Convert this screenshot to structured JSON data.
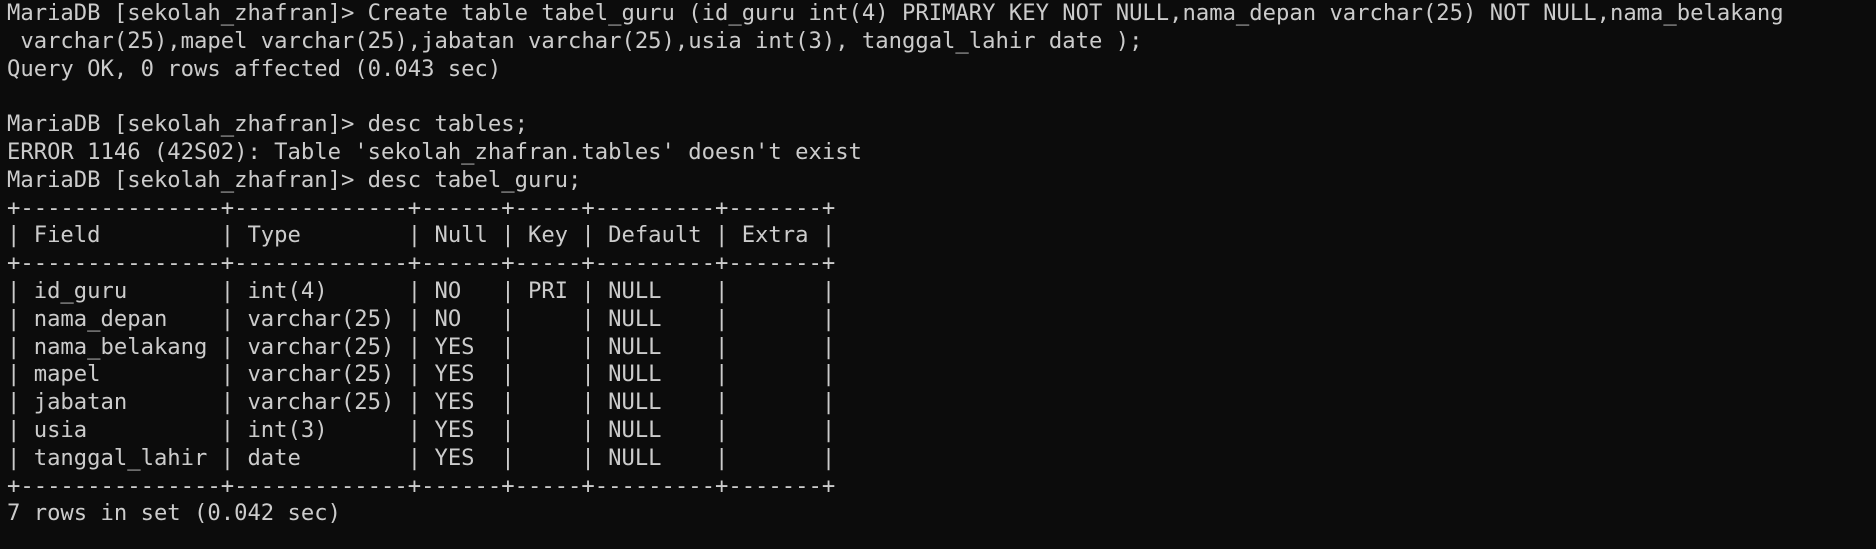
{
  "terminal": {
    "lines": [
      "MariaDB [sekolah_zhafran]> Create table tabel_guru (id_guru int(4) PRIMARY KEY NOT NULL,nama_depan varchar(25) NOT NULL,nama_belakang",
      " varchar(25),mapel varchar(25),jabatan varchar(25),usia int(3), tanggal_lahir date );",
      "Query OK, 0 rows affected (0.043 sec)",
      "",
      "MariaDB [sekolah_zhafran]> desc tables;",
      "ERROR 1146 (42S02): Table 'sekolah_zhafran.tables' doesn't exist",
      "MariaDB [sekolah_zhafran]> desc tabel_guru;",
      "+---------------+-------------+------+-----+---------+-------+",
      "| Field         | Type        | Null | Key | Default | Extra |",
      "+---------------+-------------+------+-----+---------+-------+",
      "| id_guru       | int(4)      | NO   | PRI | NULL    |       |",
      "| nama_depan    | varchar(25) | NO   |     | NULL    |       |",
      "| nama_belakang | varchar(25) | YES  |     | NULL    |       |",
      "| mapel         | varchar(25) | YES  |     | NULL    |       |",
      "| jabatan       | varchar(25) | YES  |     | NULL    |       |",
      "| usia          | int(3)      | YES  |     | NULL    |       |",
      "| tanggal_lahir | date        | YES  |     | NULL    |       |",
      "+---------------+-------------+------+-----+---------+-------+",
      "7 rows in set (0.042 sec)"
    ]
  },
  "colors": {
    "background": "#0c0c0c",
    "foreground": "#cccccc"
  }
}
